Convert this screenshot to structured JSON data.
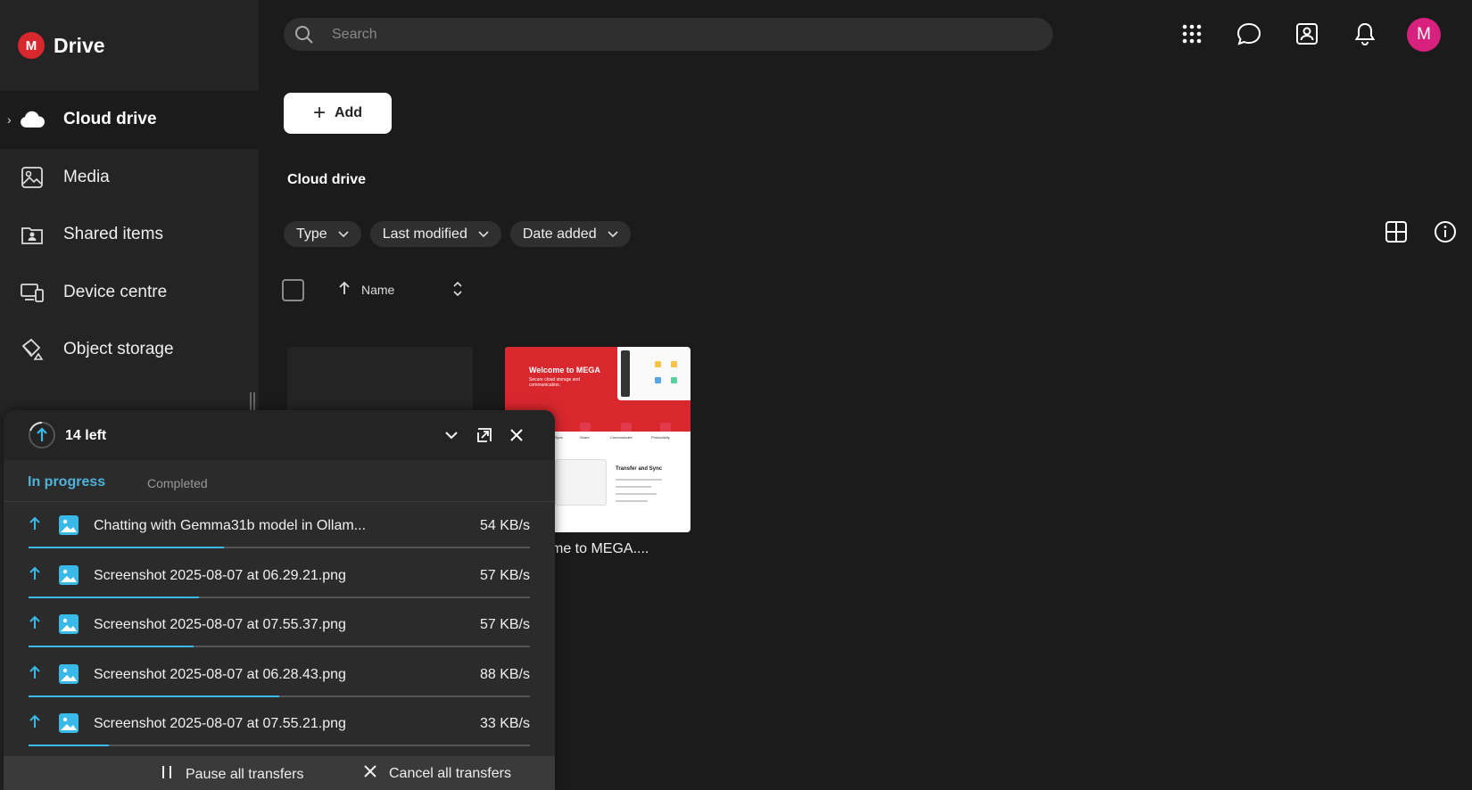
{
  "app": {
    "logo_letter": "M",
    "title": "Drive"
  },
  "sidebar": {
    "items": [
      {
        "label": "Cloud drive",
        "icon": "cloud-icon",
        "active": true
      },
      {
        "label": "Media",
        "icon": "image-icon"
      },
      {
        "label": "Shared items",
        "icon": "shared-folder-icon"
      },
      {
        "label": "Device centre",
        "icon": "devices-icon"
      },
      {
        "label": "Object storage",
        "icon": "bucket-icon"
      }
    ]
  },
  "topbar": {
    "search_placeholder": "Search",
    "avatar_letter": "M",
    "icons": [
      "apps-grid-icon",
      "chat-icon",
      "contacts-icon",
      "bell-icon"
    ]
  },
  "main": {
    "add_label": "Add",
    "page_title": "Cloud drive",
    "filters": [
      "Type",
      "Last modified",
      "Date added"
    ],
    "sort_label": "Name",
    "card_caption": "me to MEGA....",
    "thumb": {
      "title": "Welcome to MEGA",
      "subtitle": "Secure cloud storage and communication.",
      "sync_title": "Transfer and Sync",
      "features": [
        "Sync",
        "Share",
        "Communicate",
        "Productivity"
      ]
    }
  },
  "transfers": {
    "title": "14 left",
    "tabs": {
      "active": "In progress",
      "inactive": "Completed"
    },
    "rows": [
      {
        "name": "Chatting with Gemma31b model in Ollam...",
        "speed": "54 KB/s",
        "progress": 0.39
      },
      {
        "name": "Screenshot 2025-08-07 at 06.29.21.png",
        "speed": "57 KB/s",
        "progress": 0.34
      },
      {
        "name": "Screenshot 2025-08-07 at 07.55.37.png",
        "speed": "57 KB/s",
        "progress": 0.33
      },
      {
        "name": "Screenshot 2025-08-07 at 06.28.43.png",
        "speed": "88 KB/s",
        "progress": 0.5
      },
      {
        "name": "Screenshot 2025-08-07 at 07.55.21.png",
        "speed": "33 KB/s",
        "progress": 0.16
      }
    ],
    "pause_label": "Pause all transfers",
    "cancel_label": "Cancel all transfers"
  },
  "colors": {
    "brand": "#d9272e",
    "accent": "#39b9e8",
    "avatar": "#d8207f"
  }
}
